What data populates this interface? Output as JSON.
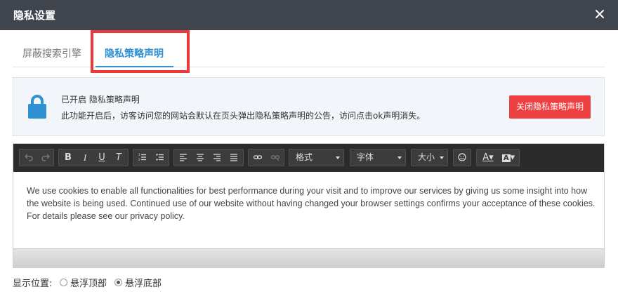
{
  "dialog": {
    "title": "隐私设置"
  },
  "tabs": [
    {
      "label": "屏蔽搜索引擎",
      "active": false
    },
    {
      "label": "隐私策略声明",
      "active": true
    }
  ],
  "notice": {
    "status": "已开启 隐私策略声明",
    "description": "此功能开启后，访客访问您的网站会默认在页头弹出隐私策略声明的公告，访问点击ok声明消失。",
    "off_button": "关闭隐私策略声明",
    "lock_color": "#2f90d2",
    "button_color": "#ee4040"
  },
  "toolbar": {
    "format_select": "格式",
    "font_select": "字体",
    "size_select": "大小",
    "icons": [
      "undo-icon",
      "redo-icon",
      "bold-icon",
      "italic-icon",
      "underline-icon",
      "clear-format-icon",
      "ordered-list-icon",
      "unordered-list-icon",
      "align-left-icon",
      "align-center-icon",
      "align-right-icon",
      "align-justify-icon",
      "link-icon",
      "unlink-icon",
      "emoji-icon",
      "font-color-icon",
      "background-color-icon"
    ]
  },
  "editor": {
    "content": "We use cookies to enable all functionalities for best performance during your visit and to improve our services by giving us some insight into how the website is being used. Continued use of our website without having changed your browser settings confirms your acceptance of these cookies. For details please see our privacy policy."
  },
  "position": {
    "label": "显示位置:",
    "options": [
      {
        "label": "悬浮顶部",
        "checked": false
      },
      {
        "label": "悬浮底部",
        "checked": true
      }
    ]
  }
}
